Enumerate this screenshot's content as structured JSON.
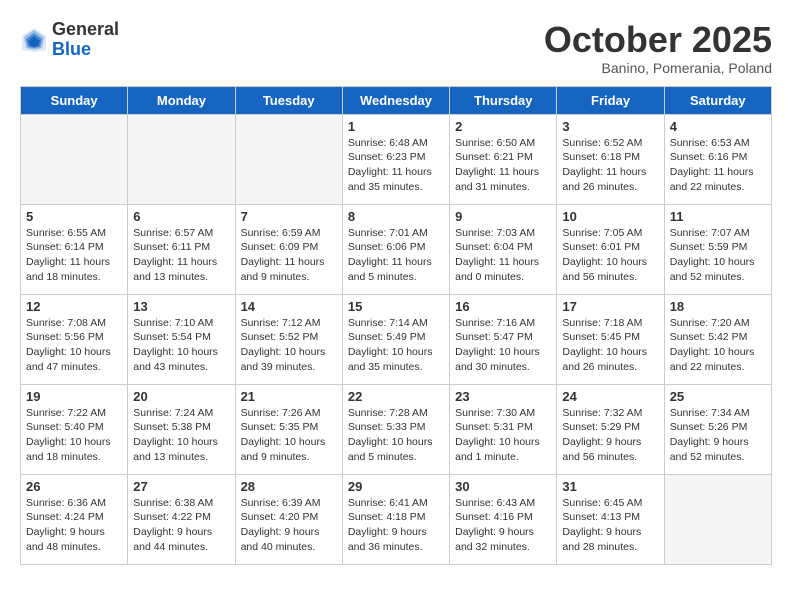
{
  "header": {
    "logo_general": "General",
    "logo_blue": "Blue",
    "month_title": "October 2025",
    "subtitle": "Banino, Pomerania, Poland"
  },
  "weekdays": [
    "Sunday",
    "Monday",
    "Tuesday",
    "Wednesday",
    "Thursday",
    "Friday",
    "Saturday"
  ],
  "weeks": [
    [
      {
        "day": "",
        "info": ""
      },
      {
        "day": "",
        "info": ""
      },
      {
        "day": "",
        "info": ""
      },
      {
        "day": "1",
        "info": "Sunrise: 6:48 AM\nSunset: 6:23 PM\nDaylight: 11 hours\nand 35 minutes."
      },
      {
        "day": "2",
        "info": "Sunrise: 6:50 AM\nSunset: 6:21 PM\nDaylight: 11 hours\nand 31 minutes."
      },
      {
        "day": "3",
        "info": "Sunrise: 6:52 AM\nSunset: 6:18 PM\nDaylight: 11 hours\nand 26 minutes."
      },
      {
        "day": "4",
        "info": "Sunrise: 6:53 AM\nSunset: 6:16 PM\nDaylight: 11 hours\nand 22 minutes."
      }
    ],
    [
      {
        "day": "5",
        "info": "Sunrise: 6:55 AM\nSunset: 6:14 PM\nDaylight: 11 hours\nand 18 minutes."
      },
      {
        "day": "6",
        "info": "Sunrise: 6:57 AM\nSunset: 6:11 PM\nDaylight: 11 hours\nand 13 minutes."
      },
      {
        "day": "7",
        "info": "Sunrise: 6:59 AM\nSunset: 6:09 PM\nDaylight: 11 hours\nand 9 minutes."
      },
      {
        "day": "8",
        "info": "Sunrise: 7:01 AM\nSunset: 6:06 PM\nDaylight: 11 hours\nand 5 minutes."
      },
      {
        "day": "9",
        "info": "Sunrise: 7:03 AM\nSunset: 6:04 PM\nDaylight: 11 hours\nand 0 minutes."
      },
      {
        "day": "10",
        "info": "Sunrise: 7:05 AM\nSunset: 6:01 PM\nDaylight: 10 hours\nand 56 minutes."
      },
      {
        "day": "11",
        "info": "Sunrise: 7:07 AM\nSunset: 5:59 PM\nDaylight: 10 hours\nand 52 minutes."
      }
    ],
    [
      {
        "day": "12",
        "info": "Sunrise: 7:08 AM\nSunset: 5:56 PM\nDaylight: 10 hours\nand 47 minutes."
      },
      {
        "day": "13",
        "info": "Sunrise: 7:10 AM\nSunset: 5:54 PM\nDaylight: 10 hours\nand 43 minutes."
      },
      {
        "day": "14",
        "info": "Sunrise: 7:12 AM\nSunset: 5:52 PM\nDaylight: 10 hours\nand 39 minutes."
      },
      {
        "day": "15",
        "info": "Sunrise: 7:14 AM\nSunset: 5:49 PM\nDaylight: 10 hours\nand 35 minutes."
      },
      {
        "day": "16",
        "info": "Sunrise: 7:16 AM\nSunset: 5:47 PM\nDaylight: 10 hours\nand 30 minutes."
      },
      {
        "day": "17",
        "info": "Sunrise: 7:18 AM\nSunset: 5:45 PM\nDaylight: 10 hours\nand 26 minutes."
      },
      {
        "day": "18",
        "info": "Sunrise: 7:20 AM\nSunset: 5:42 PM\nDaylight: 10 hours\nand 22 minutes."
      }
    ],
    [
      {
        "day": "19",
        "info": "Sunrise: 7:22 AM\nSunset: 5:40 PM\nDaylight: 10 hours\nand 18 minutes."
      },
      {
        "day": "20",
        "info": "Sunrise: 7:24 AM\nSunset: 5:38 PM\nDaylight: 10 hours\nand 13 minutes."
      },
      {
        "day": "21",
        "info": "Sunrise: 7:26 AM\nSunset: 5:35 PM\nDaylight: 10 hours\nand 9 minutes."
      },
      {
        "day": "22",
        "info": "Sunrise: 7:28 AM\nSunset: 5:33 PM\nDaylight: 10 hours\nand 5 minutes."
      },
      {
        "day": "23",
        "info": "Sunrise: 7:30 AM\nSunset: 5:31 PM\nDaylight: 10 hours\nand 1 minute."
      },
      {
        "day": "24",
        "info": "Sunrise: 7:32 AM\nSunset: 5:29 PM\nDaylight: 9 hours\nand 56 minutes."
      },
      {
        "day": "25",
        "info": "Sunrise: 7:34 AM\nSunset: 5:26 PM\nDaylight: 9 hours\nand 52 minutes."
      }
    ],
    [
      {
        "day": "26",
        "info": "Sunrise: 6:36 AM\nSunset: 4:24 PM\nDaylight: 9 hours\nand 48 minutes."
      },
      {
        "day": "27",
        "info": "Sunrise: 6:38 AM\nSunset: 4:22 PM\nDaylight: 9 hours\nand 44 minutes."
      },
      {
        "day": "28",
        "info": "Sunrise: 6:39 AM\nSunset: 4:20 PM\nDaylight: 9 hours\nand 40 minutes."
      },
      {
        "day": "29",
        "info": "Sunrise: 6:41 AM\nSunset: 4:18 PM\nDaylight: 9 hours\nand 36 minutes."
      },
      {
        "day": "30",
        "info": "Sunrise: 6:43 AM\nSunset: 4:16 PM\nDaylight: 9 hours\nand 32 minutes."
      },
      {
        "day": "31",
        "info": "Sunrise: 6:45 AM\nSunset: 4:13 PM\nDaylight: 9 hours\nand 28 minutes."
      },
      {
        "day": "",
        "info": ""
      }
    ]
  ]
}
